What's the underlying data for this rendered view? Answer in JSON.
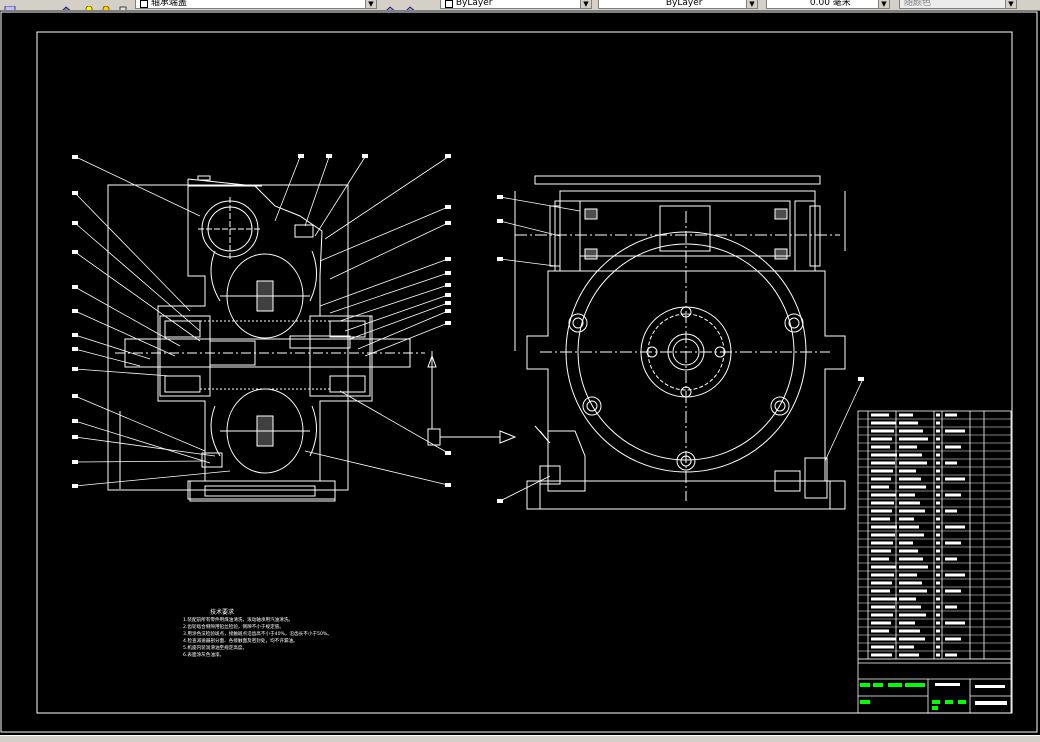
{
  "toolbar": {
    "layer_combo": "轴承端盖",
    "color_combo": "ByLayer",
    "linetype_combo": "ByLayer",
    "lineweight_combo": "0.00 毫米",
    "plotstyle_combo": "随颜色"
  },
  "drawing": {
    "notes_title": "技术要求",
    "notes": [
      "1.装配前所有零件用煤油清洗，滚动轴承用汽油清洗。",
      "2.齿轮啮合侧隙用铅丝检验，侧隙不小于规定值。",
      "3.用涂色法检验斑点，接触斑点沿齿高不小于40%，沿齿长不小于50%。",
      "4.检查减速器剖分面、各接触面及密封处，均不许漏油。",
      "5.机座内装润滑油至规定高度。",
      "6.表面涂灰色油漆。"
    ]
  },
  "colors": {
    "canvas": "#000000",
    "lines": "#ffffff",
    "highlight": "#00ff00",
    "ui_face": "#d4d0c8"
  }
}
